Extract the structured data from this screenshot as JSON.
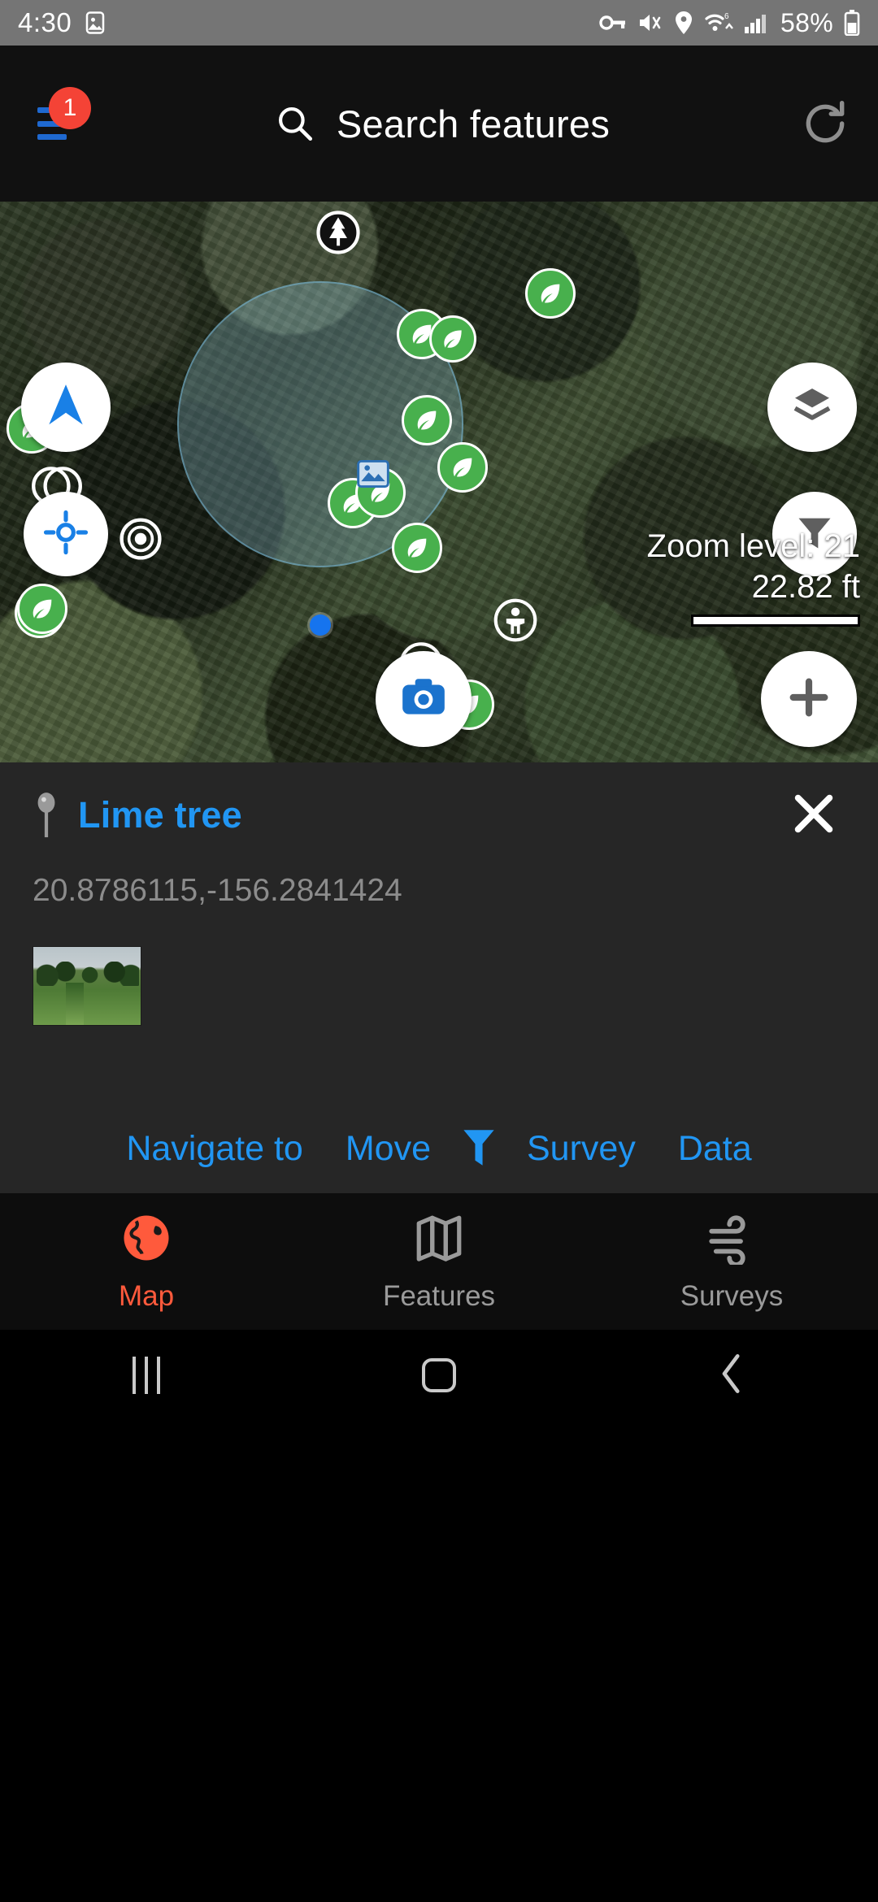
{
  "statusbar": {
    "time": "4:30",
    "battery": "58%",
    "icons": [
      "image-icon",
      "vpn-key-icon",
      "mute-icon",
      "location-icon",
      "wifi-icon",
      "signal-icon",
      "battery-icon"
    ]
  },
  "appbar": {
    "menu_badge": "1",
    "search_label": "Search features",
    "search_icon": "search-icon",
    "menu_icon": "hamburger-menu-icon",
    "refresh_icon": "refresh-icon"
  },
  "map": {
    "zoom_label": "Zoom level: 21",
    "scale_label": "22.82 ft",
    "controls": {
      "navigate_icon": "navigation-arrow-icon",
      "center_icon": "crosshair-icon",
      "layers_icon": "layers-icon",
      "filter_icon": "filter-funnel-icon",
      "camera_icon": "camera-icon",
      "add_icon": "plus-icon"
    },
    "accent_blue": "#1a73e8",
    "marker_green": "#4caf50"
  },
  "info": {
    "pin_icon": "map-pin-icon",
    "title": "Lime tree",
    "coordinates": "20.8786115,-156.2841424",
    "close_icon": "close-icon",
    "thumbnail_alt": "feature-photo",
    "title_color": "#2196f3"
  },
  "actions": [
    {
      "label": "Navigate to",
      "name": "navigate-to-button"
    },
    {
      "label": "Move",
      "name": "move-button"
    },
    {
      "label": "",
      "name": "filter-button",
      "icon": "filter-funnel-icon"
    },
    {
      "label": "Survey",
      "name": "survey-button"
    },
    {
      "label": "Data",
      "name": "data-button"
    }
  ],
  "bottomnav": {
    "active_color": "#ff5a3c",
    "items": [
      {
        "label": "Map",
        "icon": "globe-icon",
        "active": true
      },
      {
        "label": "Features",
        "icon": "map-fold-icon",
        "active": false
      },
      {
        "label": "Surveys",
        "icon": "wind-icon",
        "active": false
      }
    ]
  },
  "androidnav": {
    "recents_icon": "recents-icon",
    "home_icon": "home-icon",
    "back_icon": "back-chevron-icon"
  }
}
